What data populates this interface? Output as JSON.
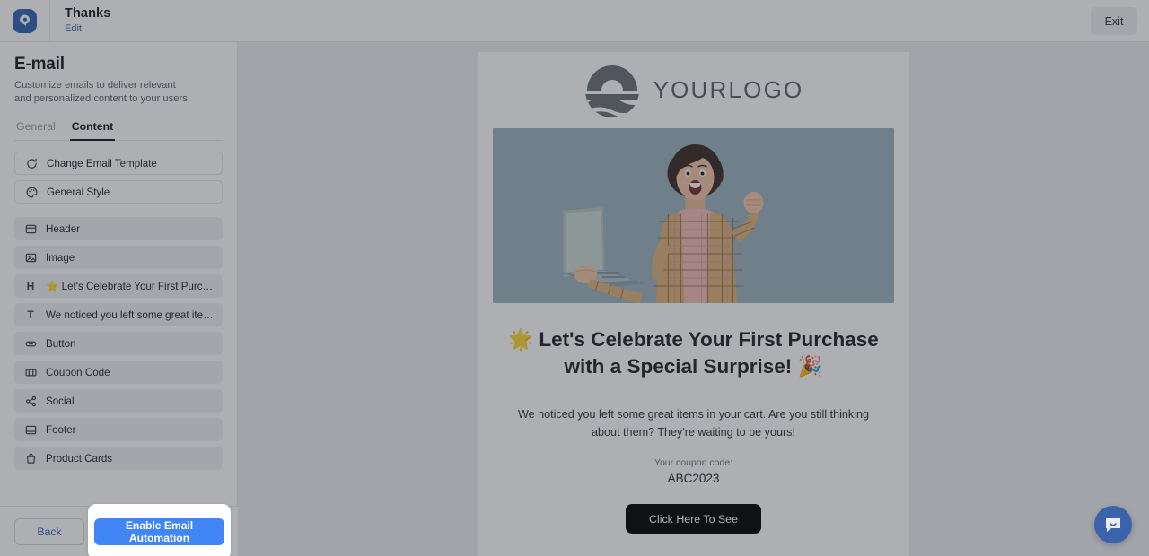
{
  "topbar": {
    "logo_icon": "app-logo-icon",
    "title": "Thanks",
    "edit_link": "Edit",
    "exit_label": "Exit"
  },
  "sidebar": {
    "title": "E-mail",
    "subtitle": "Customize emails to deliver relevant and personalized content to your users.",
    "tabs": [
      {
        "label": "General",
        "active": false
      },
      {
        "label": "Content",
        "active": true
      }
    ],
    "items": [
      {
        "label": "Change Email Template",
        "icon": "refresh-icon",
        "style": "plain"
      },
      {
        "label": "General Style",
        "icon": "palette-icon",
        "style": "plain"
      },
      {
        "label": "Header",
        "icon": "header-block-icon",
        "style": "filled"
      },
      {
        "label": "Image",
        "icon": "image-icon",
        "style": "filled"
      },
      {
        "label": "⭐ Let's Celebrate Your First Purchasewith ...",
        "icon": "heading-icon",
        "style": "filled"
      },
      {
        "label": "We noticed you left some great items in yo...",
        "icon": "text-icon",
        "style": "filled"
      },
      {
        "label": "Button",
        "icon": "button-icon",
        "style": "filled"
      },
      {
        "label": "Coupon Code",
        "icon": "ticket-icon",
        "style": "filled"
      },
      {
        "label": "Social",
        "icon": "share-icon",
        "style": "filled"
      },
      {
        "label": "Footer",
        "icon": "footer-block-icon",
        "style": "filled"
      },
      {
        "label": "Product Cards",
        "icon": "bag-icon",
        "style": "filled"
      }
    ],
    "footer": {
      "back_label": "Back",
      "enable_label": "Enable Email Automation"
    }
  },
  "email_preview": {
    "logo_text": "YOURLOGO",
    "logo_icon": "sun-wave-logo-icon",
    "hero_alt": "excited-woman-with-laptop-photo",
    "heading": "🌟 Let's Celebrate Your First Purchase with a Special Surprise! 🎉",
    "body": "We noticed you left some great items in your cart. Are you still thinking about them? They're waiting to be yours!",
    "coupon_label": "Your coupon code:",
    "coupon_code": "ABC2023",
    "cta_label": "Click Here To See"
  },
  "chat_widget": {
    "icon": "chat-bubble-icon"
  },
  "colors": {
    "accent_blue": "#4285f4",
    "brand_blue": "#2f63b5",
    "cta_black": "#000000",
    "canvas_gray": "#eceef1",
    "hero_bg": "#9cb4bf"
  }
}
